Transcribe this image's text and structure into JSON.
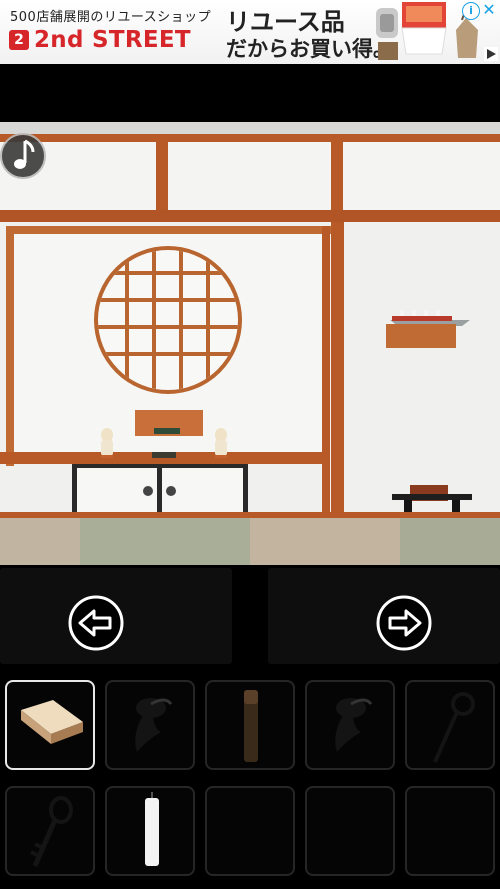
{
  "ad": {
    "line1": "500店舗展開のリユースショップ",
    "badge": "2",
    "brand": "2nd STREET",
    "tagline1": "リユース品",
    "tagline2": "だからお買い得。",
    "info_icon": "info-icon",
    "close_icon": "close-icon"
  },
  "game": {
    "music_icon": "music-note-icon",
    "nav": {
      "left_icon": "arrow-left-icon",
      "right_icon": "arrow-right-icon"
    },
    "inventory": [
      {
        "item": "wooden-box",
        "selected": true
      },
      {
        "item": "black-hook-piece",
        "selected": false
      },
      {
        "item": "wooden-stick",
        "selected": false
      },
      {
        "item": "black-hook-piece",
        "selected": false
      },
      {
        "item": "ring-rod",
        "selected": false
      },
      {
        "item": "key",
        "selected": false
      },
      {
        "item": "white-candle",
        "selected": false
      },
      {
        "item": "empty",
        "selected": false
      },
      {
        "item": "empty",
        "selected": false
      },
      {
        "item": "empty",
        "selected": false
      }
    ],
    "colors": {
      "wood": "#b85a28",
      "wall": "#f2f2f0",
      "tatami": "#a8aa96",
      "slot_border": "#262626",
      "selected_border": "#e8e8e8"
    }
  }
}
